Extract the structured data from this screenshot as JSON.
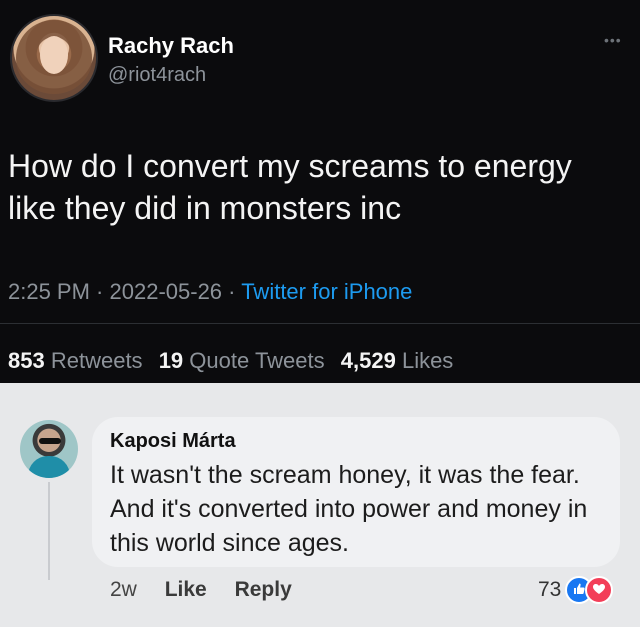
{
  "tweet": {
    "author_name": "Rachy Rach",
    "author_handle": "@riot4rach",
    "more_label": "•••",
    "text": "How do I convert my screams to energy like they did in monsters inc",
    "time": "2:25 PM",
    "date": "2022-05-26",
    "separator": " · ",
    "source": "Twitter for iPhone",
    "stats": {
      "retweets_count": "853",
      "retweets_label": "Retweets",
      "quote_count": "19",
      "quote_label": "Quote Tweets",
      "likes_count": "4,529",
      "likes_label": "Likes"
    }
  },
  "comment": {
    "author_name": "Kaposi Márta",
    "text": "It wasn't the scream honey, it was the fear. And it's converted into power and money in this world since ages.",
    "age": "2w",
    "like_label": "Like",
    "reply_label": "Reply",
    "reaction_count": "73",
    "reactions": [
      "like-icon",
      "love-icon"
    ],
    "colors": {
      "like": "#1877f2",
      "love": "#f33e58"
    }
  },
  "colors": {
    "tweet_bg": "#0b0b0d",
    "link": "#1d9bf0",
    "page_bg": "#e7e8ea"
  }
}
